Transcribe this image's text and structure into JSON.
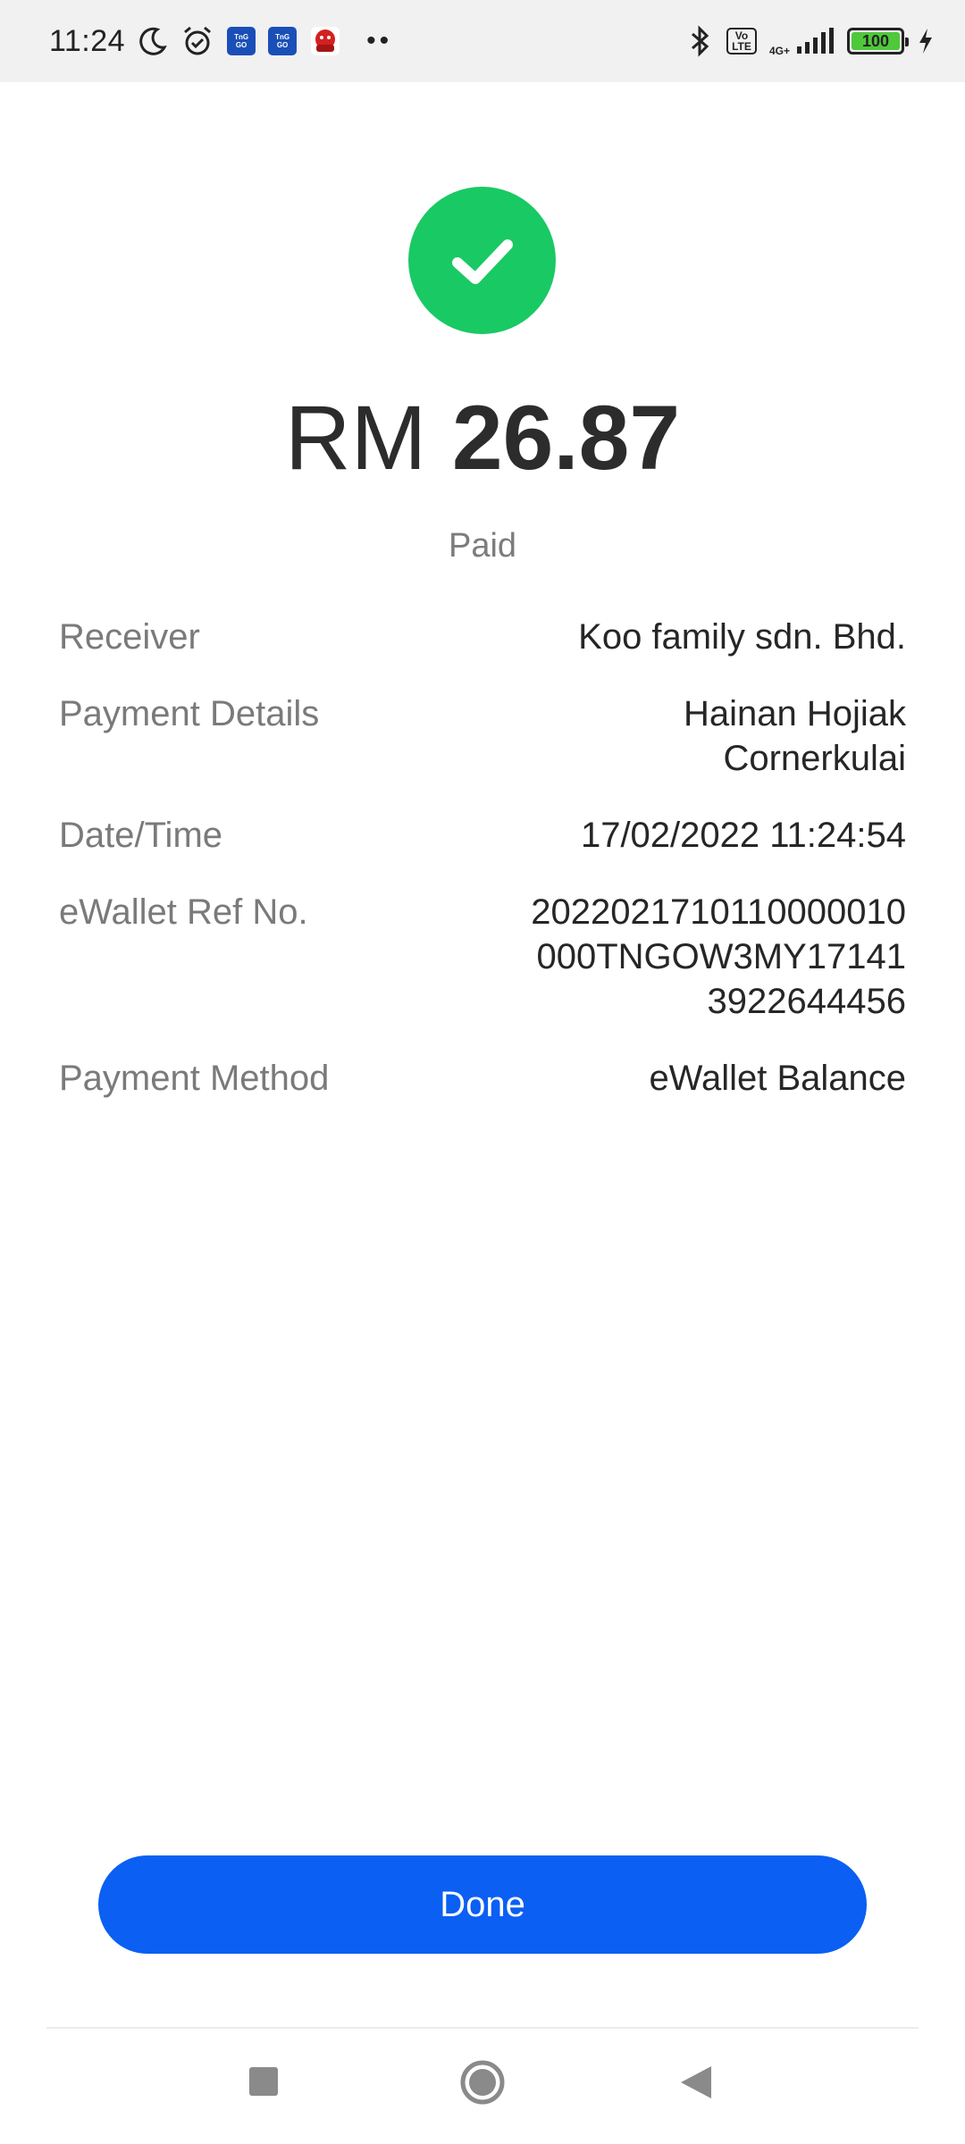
{
  "status_bar": {
    "time": "11:24",
    "app_icons": [
      "moon-icon",
      "alarm-icon",
      "touch-n-go-icon",
      "touch-n-go-icon",
      "game-app-icon"
    ],
    "overflow": "••",
    "volte": "Vo\nLTE",
    "network": "4G+",
    "battery": "100"
  },
  "payment": {
    "currency": "RM",
    "amount": "26.87",
    "status": "Paid",
    "accent_color": "#19c964"
  },
  "details": [
    {
      "label": "Receiver",
      "value": "Koo family sdn. Bhd."
    },
    {
      "label": "Payment Details",
      "value": "Hainan Hojiak\nCornerkulai"
    },
    {
      "label": "Date/Time",
      "value": "17/02/2022 11:24:54"
    },
    {
      "label": "eWallet Ref No.",
      "value": "2022021710110000010\n000TNGOW3MY17141\n3922644456"
    },
    {
      "label": "Payment Method",
      "value": "eWallet Balance"
    }
  ],
  "actions": {
    "done_label": "Done",
    "button_color": "#0b5ff3"
  },
  "navigation": {
    "items": [
      "recents-button",
      "home-button",
      "back-button"
    ]
  }
}
